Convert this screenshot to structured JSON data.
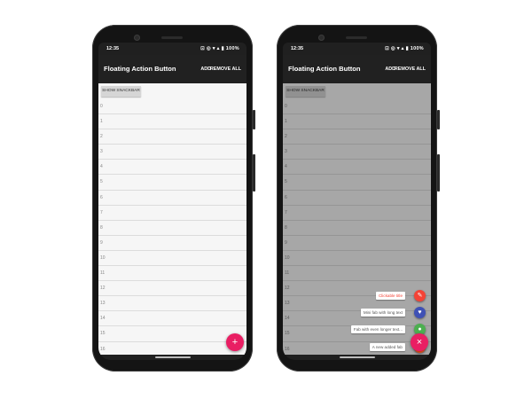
{
  "status_bar": {
    "time": "12:35",
    "icons": "⊡ ◎ ▾ ▴ ▮ 100%"
  },
  "app_bar": {
    "title": "Floating Action Button",
    "add_label": "ADD",
    "remove_all_label": "REMOVE ALL"
  },
  "snackbar_button_label": "SHOW SNACKBAR",
  "list_items": [
    "0",
    "1",
    "2",
    "3",
    "4",
    "5",
    "6",
    "7",
    "8",
    "9",
    "10",
    "11",
    "12",
    "13",
    "14",
    "15",
    "16",
    "17"
  ],
  "fab": {
    "icon": "plus-icon",
    "glyph": "+",
    "close_glyph": "×",
    "color": "#e91e63"
  },
  "speed_dial": [
    {
      "label": "Clickable title",
      "icon": "pencil-icon",
      "glyph": "✎",
      "color": "#f44336",
      "label_color": "#f44336"
    },
    {
      "label": "Mini fab with long text",
      "icon": "heart-icon",
      "glyph": "♥",
      "color": "#3f51b5",
      "label_color": "#555555"
    },
    {
      "label": "Fab with even longer text...",
      "icon": "person-icon",
      "glyph": "●",
      "color": "#4caf50",
      "label_color": "#555555"
    },
    {
      "label": "A new added fab",
      "icon": "",
      "glyph": "",
      "color": "#ff5722",
      "label_color": "#555555"
    }
  ]
}
